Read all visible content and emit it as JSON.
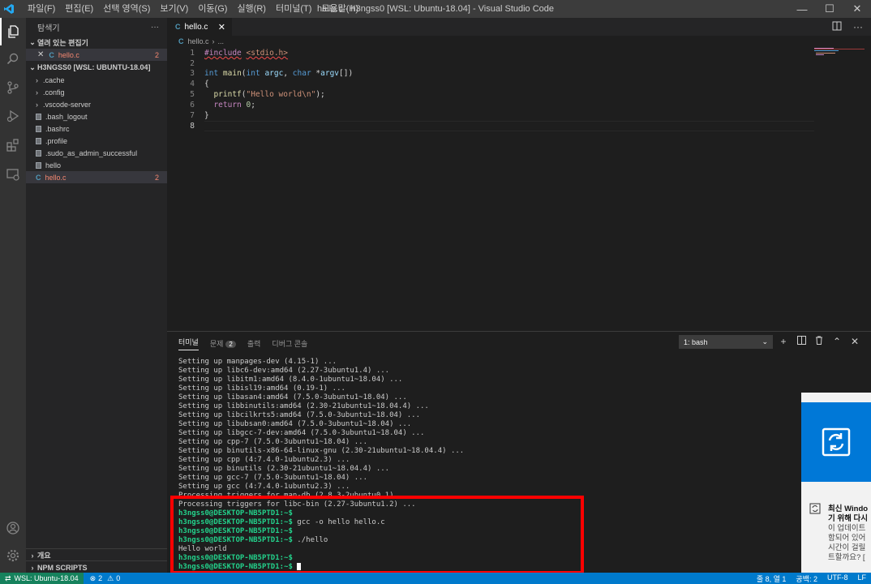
{
  "window": {
    "title": "hello.c - h3ngss0 [WSL: Ubuntu-18.04] - Visual Studio Code",
    "menu": [
      "파일(F)",
      "편집(E)",
      "선택 영역(S)",
      "보기(V)",
      "이동(G)",
      "실행(R)",
      "터미널(T)",
      "도움말(H)"
    ]
  },
  "sidebar": {
    "title": "탐색기",
    "more": "···",
    "open_editors": {
      "header": "열려 있는 편집기",
      "items": [
        {
          "name": "hello.c",
          "badge": "2"
        }
      ]
    },
    "workspace": {
      "header": "H3NGSS0 [WSL: UBUNTU-18.04]",
      "items": [
        {
          "name": ".cache",
          "kind": "folder"
        },
        {
          "name": ".config",
          "kind": "folder"
        },
        {
          "name": ".vscode-server",
          "kind": "folder"
        },
        {
          "name": ".bash_logout",
          "kind": "file"
        },
        {
          "name": ".bashrc",
          "kind": "file"
        },
        {
          "name": ".profile",
          "kind": "file"
        },
        {
          "name": ".sudo_as_admin_successful",
          "kind": "file"
        },
        {
          "name": "hello",
          "kind": "file"
        },
        {
          "name": "hello.c",
          "kind": "c",
          "badge": "2"
        }
      ]
    },
    "outline_header": "개요",
    "npm_header": "NPM SCRIPTS"
  },
  "editor": {
    "tab": "hello.c",
    "breadcrumb": [
      "hello.c",
      "..."
    ],
    "line_numbers": [
      "1",
      "2",
      "3",
      "4",
      "5",
      "6",
      "7",
      "8"
    ]
  },
  "panel": {
    "tabs": {
      "terminal": "터미널",
      "problems": "문제",
      "problems_count": "2",
      "output": "출력",
      "debug": "디버그 콘솔"
    },
    "shell_select": "1: bash",
    "terminal_lines": [
      "Setting up manpages-dev (4.15-1) ...",
      "Setting up libc6-dev:amd64 (2.27-3ubuntu1.4) ...",
      "Setting up libitm1:amd64 (8.4.0-1ubuntu1~18.04) ...",
      "Setting up libisl19:amd64 (0.19-1) ...",
      "Setting up libasan4:amd64 (7.5.0-3ubuntu1~18.04) ...",
      "Setting up libbinutils:amd64 (2.30-21ubuntu1~18.04.4) ...",
      "Setting up libcilkrts5:amd64 (7.5.0-3ubuntu1~18.04) ...",
      "Setting up libubsan0:amd64 (7.5.0-3ubuntu1~18.04) ...",
      "Setting up libgcc-7-dev:amd64 (7.5.0-3ubuntu1~18.04) ...",
      "Setting up cpp-7 (7.5.0-3ubuntu1~18.04) ...",
      "Setting up binutils-x86-64-linux-gnu (2.30-21ubuntu1~18.04.4) ...",
      "Setting up cpp (4:7.4.0-1ubuntu2.3) ...",
      "Setting up binutils (2.30-21ubuntu1~18.04.4) ...",
      "Setting up gcc-7 (7.5.0-3ubuntu1~18.04) ...",
      "Setting up gcc (4:7.4.0-1ubuntu2.3) ...",
      "Processing triggers for man-db (2.8.3-2ubuntu0.1) ...",
      "Processing triggers for libc-bin (2.27-3ubuntu1.2) ..."
    ],
    "prompt": "h3ngss0@DESKTOP-NB5PTD1:~$",
    "commands": [
      "",
      " gcc -o hello hello.c",
      "",
      " ./hello"
    ],
    "output_line": "Hello world",
    "final_prompts": [
      "",
      " "
    ]
  },
  "status": {
    "remote": "WSL: Ubuntu-18.04",
    "errors": "2",
    "warnings": "0",
    "position": "줄 8, 열 1",
    "spaces": "공백: 2",
    "encoding": "UTF-8",
    "eol": "LF"
  },
  "toast": {
    "title_lines": [
      "최신 Windo",
      "기 위해 다시"
    ],
    "body_lines": [
      "이 업데이트",
      "함되어 있어",
      "시간이 걸릴",
      "트할까요? ["
    ]
  }
}
